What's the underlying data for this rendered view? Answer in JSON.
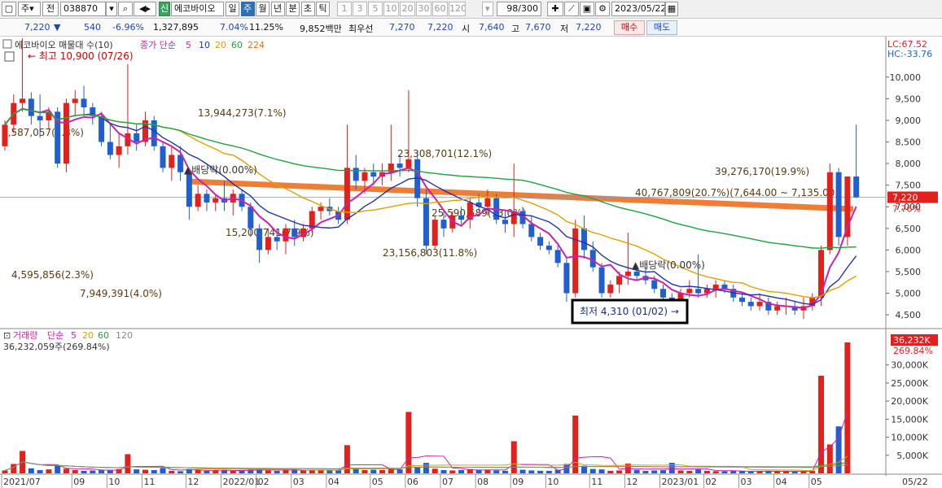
{
  "toolbar": {
    "market_type": "주",
    "market_all": "전",
    "code": "038870",
    "credit_badge": "신",
    "stock_name": "에코바이오",
    "periods": [
      "일",
      "주",
      "월",
      "년",
      "분",
      "초",
      "틱"
    ],
    "active_period": "주",
    "intervals": [
      "1",
      "3",
      "5",
      "10",
      "20",
      "30",
      "60",
      "120"
    ],
    "count": "98/300",
    "date": "2023/05/22"
  },
  "quote": {
    "price": "7,220",
    "change": "540",
    "change_pct": "-6.96%",
    "volume": "1,327,895",
    "ratio1": "7.04%",
    "ratio2": "11.25%",
    "amount": "9,852백만",
    "best_label": "최우선",
    "best_ask": "7,270",
    "best_bid": "7,220",
    "open_label": "시",
    "open": "7,640",
    "high_label": "고",
    "high": "7,670",
    "low_label": "저",
    "low": "7,220",
    "buy_label": "매수",
    "sell_label": "매도"
  },
  "price_panel": {
    "legend_title": "에코바이오 매물대 수(10)",
    "ma_label": "종가 단순",
    "ma_periods": [
      "5",
      "10",
      "20",
      "60",
      "224"
    ],
    "ma_colors": [
      "#cc22aa",
      "#2233aa",
      "#e0a000",
      "#22a040",
      "#f07020"
    ],
    "lc": "LC:67.52",
    "hc": "HC:-33.76",
    "y_ticks": [
      "10,000",
      "9,500",
      "9,000",
      "8,500",
      "8,000",
      "7,500",
      "7,000",
      "6,500",
      "6,000",
      "5,500",
      "5,000",
      "4,500"
    ],
    "current_price": "7,220",
    "current_pct": "7.76%",
    "high_marker": "최고 10,900 (07/26)",
    "low_marker": "최저 4,310 (01/02)",
    "dividend_labels": [
      "배당락(0.00%)",
      "배당락(0.00%)"
    ],
    "profile_labels": [
      "13,944,273(7.1%)",
      "23,308,701(12.1%)",
      "39,276,170(19.9%)",
      "40,767,809(20.7%)(7,644.00 ~ 7,135.00)",
      "25,590,589(13.0%)",
      "15,200,741(7.9%)",
      "23,156,803(11.8%)",
      "4,595,856(2.3%)",
      "7,949,391(4.0%)",
      "5,587,057(2.3%)"
    ]
  },
  "volume_panel": {
    "legend_title": "거래량",
    "ma_label": "단순",
    "ma_periods": [
      "5",
      "20",
      "60",
      "120"
    ],
    "ma_colors": [
      "#cc22aa",
      "#e0a000",
      "#22a040",
      "#888888"
    ],
    "volume_text": "36,232,059주(269.84%)",
    "y_ticks": [
      "30,000K",
      "25,000K",
      "20,000K",
      "15,000K",
      "10,000K",
      "5,000K"
    ],
    "current_volume": "36,232K",
    "current_pct": "269.84%"
  },
  "x_axis": {
    "labels": [
      "2021/07",
      "09",
      "10",
      "11",
      "12",
      "2022/01",
      "02",
      "03",
      "04",
      "05",
      "06",
      "07",
      "08",
      "09",
      "10",
      "11",
      "12",
      "2023/01",
      "02",
      "03",
      "04",
      "05"
    ],
    "right_label": "05/22"
  },
  "chart_data": {
    "type": "candlestick",
    "interval": "weekly",
    "price_ylim": [
      4200,
      10900
    ],
    "volume_ylim": [
      0,
      36232
    ],
    "volume_unit": "K shares",
    "months": [
      {
        "label": "2021/07",
        "week": 0
      },
      {
        "label": "09",
        "week": 8
      },
      {
        "label": "10",
        "week": 12
      },
      {
        "label": "11",
        "week": 16
      },
      {
        "label": "12",
        "week": 21
      },
      {
        "label": "2022/01",
        "week": 25
      },
      {
        "label": "02",
        "week": 29
      },
      {
        "label": "03",
        "week": 33
      },
      {
        "label": "04",
        "week": 37
      },
      {
        "label": "05",
        "week": 42
      },
      {
        "label": "06",
        "week": 46
      },
      {
        "label": "07",
        "week": 50
      },
      {
        "label": "08",
        "week": 54
      },
      {
        "label": "09",
        "week": 58
      },
      {
        "label": "10",
        "week": 62
      },
      {
        "label": "11",
        "week": 67
      },
      {
        "label": "12",
        "week": 71
      },
      {
        "label": "2023/01",
        "week": 75
      },
      {
        "label": "02",
        "week": 80
      },
      {
        "label": "03",
        "week": 84
      },
      {
        "label": "04",
        "week": 88
      },
      {
        "label": "05",
        "week": 92
      }
    ],
    "ohlc": [
      [
        8400,
        9000,
        8300,
        8900
      ],
      [
        8900,
        9600,
        8700,
        9400
      ],
      [
        9400,
        10900,
        9200,
        9500
      ],
      [
        9500,
        9650,
        8900,
        9100
      ],
      [
        9100,
        9600,
        8600,
        9000
      ],
      [
        9000,
        9300,
        8800,
        9200
      ],
      [
        9200,
        9300,
        7900,
        8000
      ],
      [
        8000,
        9500,
        7800,
        9400
      ],
      [
        9400,
        9700,
        9100,
        9500
      ],
      [
        9500,
        9800,
        9100,
        9300
      ],
      [
        9300,
        9400,
        8900,
        9100
      ],
      [
        9100,
        9200,
        8400,
        8500
      ],
      [
        8500,
        8900,
        8100,
        8200
      ],
      [
        8200,
        8700,
        7900,
        8400
      ],
      [
        8400,
        10300,
        8200,
        8700
      ],
      [
        8700,
        8900,
        8300,
        8500
      ],
      [
        8500,
        9200,
        8400,
        9000
      ],
      [
        9000,
        9100,
        8300,
        8400
      ],
      [
        8400,
        8500,
        7800,
        7900
      ],
      [
        7900,
        8400,
        7600,
        8200
      ],
      [
        8200,
        8400,
        7600,
        7800
      ],
      [
        7800,
        7900,
        6700,
        7000
      ],
      [
        7000,
        7500,
        6900,
        7300
      ],
      [
        7300,
        7400,
        6900,
        7100
      ],
      [
        7100,
        7300,
        6900,
        7200
      ],
      [
        7200,
        7600,
        6900,
        7100
      ],
      [
        7100,
        7400,
        6800,
        7300
      ],
      [
        7300,
        7400,
        6900,
        7000
      ],
      [
        7000,
        7100,
        6300,
        6500
      ],
      [
        6500,
        6600,
        5700,
        6000
      ],
      [
        6000,
        6500,
        5900,
        6300
      ],
      [
        6300,
        6500,
        6000,
        6200
      ],
      [
        6200,
        6600,
        5900,
        6500
      ],
      [
        6500,
        6700,
        6100,
        6300
      ],
      [
        6300,
        6600,
        6200,
        6500
      ],
      [
        6500,
        7000,
        6400,
        6900
      ],
      [
        6900,
        7100,
        6700,
        7000
      ],
      [
        7000,
        7200,
        6800,
        6900
      ],
      [
        6900,
        7000,
        6600,
        6700
      ],
      [
        6700,
        8900,
        6600,
        7900
      ],
      [
        7900,
        8200,
        7400,
        7600
      ],
      [
        7600,
        7900,
        7300,
        7800
      ],
      [
        7800,
        8000,
        7500,
        7700
      ],
      [
        7700,
        8000,
        7500,
        7800
      ],
      [
        7800,
        8900,
        7600,
        8000
      ],
      [
        8000,
        8200,
        7700,
        7900
      ],
      [
        7900,
        9700,
        7800,
        8100
      ],
      [
        8100,
        8300,
        7000,
        7200
      ],
      [
        7200,
        7400,
        5900,
        6100
      ],
      [
        6100,
        6800,
        6000,
        6700
      ],
      [
        6700,
        6900,
        6300,
        6500
      ],
      [
        6500,
        6900,
        6400,
        6800
      ],
      [
        6800,
        7000,
        6600,
        6700
      ],
      [
        6700,
        7200,
        6500,
        7100
      ],
      [
        7100,
        7300,
        6900,
        7000
      ],
      [
        7000,
        7400,
        6800,
        7200
      ],
      [
        7200,
        7300,
        6600,
        6700
      ],
      [
        6700,
        6900,
        6400,
        6600
      ],
      [
        6600,
        8000,
        6300,
        6900
      ],
      [
        6900,
        7000,
        6500,
        6600
      ],
      [
        6600,
        6800,
        6200,
        6300
      ],
      [
        6300,
        6400,
        6000,
        6100
      ],
      [
        6100,
        6200,
        5900,
        6000
      ],
      [
        6000,
        6100,
        5600,
        5700
      ],
      [
        5700,
        5800,
        4800,
        5000
      ],
      [
        5000,
        6700,
        4900,
        6500
      ],
      [
        6500,
        6800,
        5800,
        6000
      ],
      [
        6000,
        6200,
        5500,
        5600
      ],
      [
        5600,
        5700,
        4900,
        5000
      ],
      [
        5000,
        5300,
        4900,
        5200
      ],
      [
        5200,
        5500,
        5000,
        5400
      ],
      [
        5400,
        6400,
        5200,
        5500
      ],
      [
        5500,
        5600,
        5300,
        5400
      ],
      [
        5400,
        5600,
        5200,
        5300
      ],
      [
        5300,
        5400,
        5000,
        5100
      ],
      [
        5100,
        5200,
        4800,
        4900
      ],
      [
        4900,
        5000,
        4310,
        4700
      ],
      [
        4700,
        5100,
        4600,
        5000
      ],
      [
        5000,
        5300,
        4900,
        5100
      ],
      [
        5100,
        5900,
        4900,
        5000
      ],
      [
        5000,
        5200,
        4900,
        5100
      ],
      [
        5100,
        5300,
        4900,
        5200
      ],
      [
        5200,
        5300,
        5000,
        5100
      ],
      [
        5100,
        5200,
        4800,
        4900
      ],
      [
        4900,
        5000,
        4700,
        4800
      ],
      [
        4800,
        4900,
        4600,
        4700
      ],
      [
        4700,
        5000,
        4600,
        4800
      ],
      [
        4800,
        4900,
        4500,
        4600
      ],
      [
        4600,
        4800,
        4500,
        4700
      ],
      [
        4700,
        4900,
        4500,
        4700
      ],
      [
        4700,
        4800,
        4500,
        4600
      ],
      [
        4600,
        4900,
        4400,
        4700
      ],
      [
        4700,
        5000,
        4600,
        4900
      ],
      [
        4900,
        6100,
        4700,
        6000
      ],
      [
        6000,
        8000,
        5900,
        7800
      ],
      [
        7800,
        7900,
        6100,
        6300
      ],
      [
        6300,
        7400,
        6100,
        7700
      ],
      [
        7700,
        8900,
        7200,
        7220
      ]
    ],
    "volume": [
      800,
      2600,
      6200,
      1400,
      900,
      1100,
      2300,
      1300,
      900,
      700,
      800,
      1000,
      900,
      1200,
      5300,
      1100,
      1000,
      900,
      1500,
      700,
      600,
      1200,
      900,
      700,
      800,
      900,
      700,
      800,
      1000,
      1300,
      800,
      700,
      900,
      1100,
      800,
      1000,
      900,
      800,
      1000,
      7800,
      1300,
      900,
      1000,
      900,
      1400,
      1100,
      17000,
      1600,
      2900,
      1300,
      900,
      800,
      900,
      1200,
      900,
      1000,
      800,
      700,
      8900,
      1000,
      800,
      700,
      700,
      1000,
      2600,
      16000,
      2100,
      1200,
      1100,
      700,
      800,
      2700,
      1000,
      700,
      800,
      900,
      2900,
      800,
      700,
      1100,
      700,
      600,
      600,
      700,
      600,
      500,
      600,
      700,
      600,
      600,
      500,
      600,
      700,
      27000,
      8000,
      13000,
      36232
    ]
  }
}
